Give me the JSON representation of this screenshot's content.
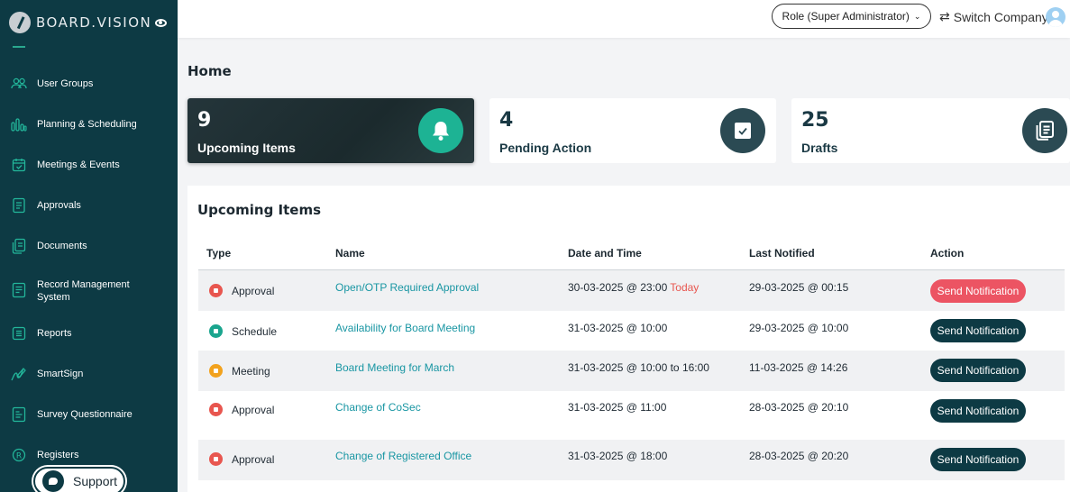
{
  "app": {
    "logo_text": "BOARD.VISION"
  },
  "sidebar": {
    "items": [
      {
        "label": "User Groups",
        "icon": "users-icon"
      },
      {
        "label": "Planning & Scheduling",
        "icon": "bar-chart-icon"
      },
      {
        "label": "Meetings & Events",
        "icon": "calendar-icon"
      },
      {
        "label": "Approvals",
        "icon": "document-check-icon"
      },
      {
        "label": "Documents",
        "icon": "documents-icon"
      },
      {
        "label": "Record Management System",
        "icon": "records-icon"
      },
      {
        "label": "Reports",
        "icon": "report-icon"
      },
      {
        "label": "SmartSign",
        "icon": "signature-icon"
      },
      {
        "label": "Survey Questionnaire",
        "icon": "survey-icon"
      },
      {
        "label": "Registers",
        "icon": "registered-icon"
      }
    ],
    "support_label": "Support"
  },
  "header": {
    "role_label": "Role (Super Administrator)",
    "switch_company_label": "Switch Company"
  },
  "page_title": "Home",
  "stats": [
    {
      "count": "9",
      "label": "Upcoming Items",
      "icon": "bell-icon",
      "active": true
    },
    {
      "count": "4",
      "label": "Pending Action",
      "icon": "checkbox-icon"
    },
    {
      "count": "25",
      "label": "Drafts",
      "icon": "drafts-icon"
    }
  ],
  "upcoming": {
    "title": "Upcoming Items",
    "columns": [
      "Type",
      "Name",
      "Date and Time",
      "Last Notified",
      "Action"
    ],
    "rows": [
      {
        "type": "Approval",
        "name": "Open/OTP Required Approval",
        "datetime": "30-03-2025 @ 23:00",
        "flag": "Today",
        "last_notified": "29-03-2025 @ 00:15",
        "action": "Send Notification",
        "highlight": true
      },
      {
        "type": "Schedule",
        "name": "Availability for Board Meeting",
        "datetime": "31-03-2025 @ 10:00",
        "flag": "",
        "last_notified": "29-03-2025 @ 10:00",
        "action": "Send Notification"
      },
      {
        "type": "Meeting",
        "name": "Board Meeting for March",
        "datetime": "31-03-2025 @ 10:00 to 16:00",
        "flag": "",
        "last_notified": "11-03-2025 @ 14:26",
        "action": "Send Notification"
      },
      {
        "type": "Approval",
        "name": "Change of CoSec",
        "datetime": "31-03-2025 @ 11:00",
        "flag": "",
        "last_notified": "28-03-2025 @ 20:10",
        "action": "Send Notification"
      },
      {
        "type": "Approval",
        "name": "Change of Registered Office",
        "datetime": "31-03-2025 @ 18:00",
        "flag": "",
        "last_notified": "28-03-2025 @ 20:20",
        "action": "Send Notification"
      }
    ]
  },
  "colors": {
    "sidebar_bg": "#0d3a44",
    "accent": "#23b79b",
    "link": "#1996a3",
    "button_dark": "#0d3a44",
    "button_alert": "#ec5463",
    "approval": "#e8564f",
    "schedule": "#1aa58e",
    "meeting": "#f2a21d"
  }
}
